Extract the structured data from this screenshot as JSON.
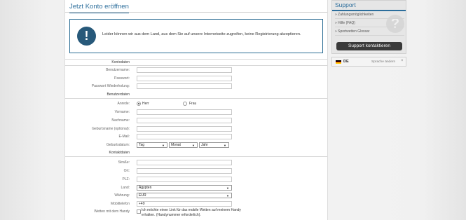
{
  "page": {
    "title": "Jetzt Konto eröffnen",
    "alert_text": "Leider können wir aus dem Land, aus dem Sie auf unsere Internetseite zugreifen, keine Registrierung akzeptieren.",
    "alert_icon": "exclamation-icon",
    "accent_color": "#2c6e9c"
  },
  "sections": {
    "kontodaten": "Kontodaten",
    "benutzerdaten": "Benutzerdaten",
    "kontaktdaten": "Kontaktdaten"
  },
  "fields": {
    "benutzername": "Benutzername:",
    "passwort": "Passwort:",
    "passwort_wdh": "Passwort Wiederholung:",
    "anrede": "Anrede:",
    "anrede_herr": "Herr",
    "anrede_frau": "Frau",
    "vorname": "Vorname:",
    "nachname": "Nachname:",
    "geburtsname": "Geburtsname (optional):",
    "email": "E-Mail:",
    "geburtsdatum": "Geburtsdatum:",
    "tag": "Tag",
    "monat": "Monat",
    "jahr": "Jahr",
    "strasse": "Straße:",
    "ort": "Ort:",
    "plz": "PLZ:",
    "land": "Land:",
    "land_value": "Ägypten",
    "waehrung": "Währung:",
    "waehrung_value": "EUR",
    "mobiltelefon": "Mobiltelefon",
    "mobil_value": "+49",
    "wetten_handy": "Wetten mit dem Handy",
    "wetten_text": "Ich möchte einen Link für das mobile Wetten auf meinem Handy erhalten. (Handynummer erforderlich)."
  },
  "support": {
    "title": "Support",
    "links": [
      "Zahlungsmöglichkeiten",
      "Hilfe (FAQ)",
      "Sportwetten Glossar"
    ],
    "button": "Support kontaktieren"
  },
  "language": {
    "code": "DE",
    "change": "Sprache ändern",
    "close": "×"
  }
}
